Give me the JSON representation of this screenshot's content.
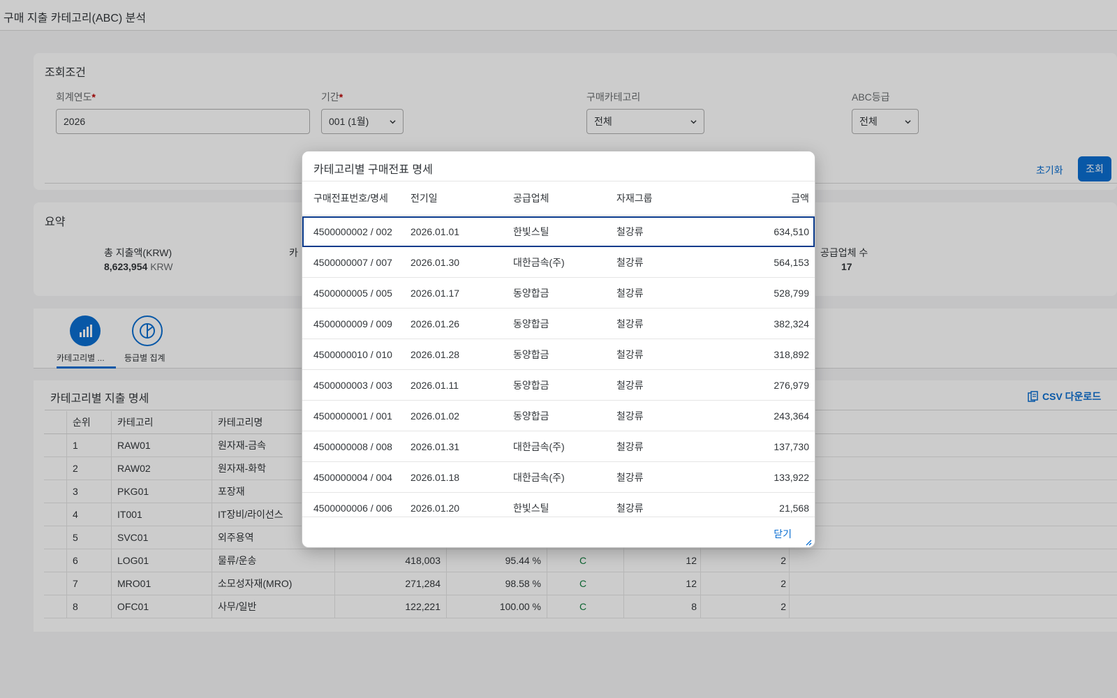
{
  "app": {
    "title": "구매 지출 카테고리(ABC) 분석"
  },
  "filter": {
    "title": "조회조건",
    "fiscal_year_label": "회계연도",
    "fiscal_year_value": "2026",
    "period_label": "기간",
    "period_value": "001 (1월)",
    "category_label": "구매카테고리",
    "category_value": "전체",
    "abc_label": "ABC등급",
    "abc_value": "전체",
    "required_mark": "*",
    "reset_label": "초기화",
    "search_label": "조회"
  },
  "summary": {
    "title": "요약",
    "total_label": "총 지출액(KRW)",
    "total_value": "8,623,954",
    "total_unit": "KRW",
    "partial_label": "카",
    "vendor_label": "공급업체 수",
    "vendor_value": "17"
  },
  "tabs": [
    {
      "label": "카테고리별 ...",
      "icon": "bar-chart-icon"
    },
    {
      "label": "등급별 집계",
      "icon": "pie-chart-icon"
    }
  ],
  "table": {
    "title": "카테고리별 지출 명세",
    "csv_label": "CSV 다운로드",
    "columns": [
      "순위",
      "카테고리",
      "카테고리명"
    ],
    "rows": [
      {
        "rank": "1",
        "code": "RAW01",
        "name": "원자재-금속",
        "amount": "",
        "cum": "",
        "grade": "",
        "docs": "",
        "vendors": ""
      },
      {
        "rank": "2",
        "code": "RAW02",
        "name": "원자재-화학",
        "amount": "",
        "cum": "",
        "grade": "",
        "docs": "",
        "vendors": ""
      },
      {
        "rank": "3",
        "code": "PKG01",
        "name": "포장재",
        "amount": "",
        "cum": "",
        "grade": "",
        "docs": "",
        "vendors": ""
      },
      {
        "rank": "4",
        "code": "IT001",
        "name": "IT장비/라이선스",
        "amount": "",
        "cum": "",
        "grade": "",
        "docs": "",
        "vendors": ""
      },
      {
        "rank": "5",
        "code": "SVC01",
        "name": "외주용역",
        "amount": "",
        "cum": "",
        "grade": "",
        "docs": "",
        "vendors": ""
      },
      {
        "rank": "6",
        "code": "LOG01",
        "name": "물류/운송",
        "amount": "418,003",
        "cum": "95.44 %",
        "grade": "C",
        "docs": "12",
        "vendors": "2"
      },
      {
        "rank": "7",
        "code": "MRO01",
        "name": "소모성자재(MRO)",
        "amount": "271,284",
        "cum": "98.58 %",
        "grade": "C",
        "docs": "12",
        "vendors": "2"
      },
      {
        "rank": "8",
        "code": "OFC01",
        "name": "사무/일반",
        "amount": "122,221",
        "cum": "100.00 %",
        "grade": "C",
        "docs": "8",
        "vendors": "2"
      }
    ]
  },
  "dialog": {
    "title": "카테고리별 구매전표 명세",
    "columns": [
      "구매전표번호/명세",
      "전기일",
      "공급업체",
      "자재그룹",
      "금액"
    ],
    "rows": [
      {
        "doc": "4500000002 / 002",
        "date": "2026.01.01",
        "vendor": "한빛스틸",
        "group": "철강류",
        "amount": "634,510"
      },
      {
        "doc": "4500000007 / 007",
        "date": "2026.01.30",
        "vendor": "대한금속(주)",
        "group": "철강류",
        "amount": "564,153"
      },
      {
        "doc": "4500000005 / 005",
        "date": "2026.01.17",
        "vendor": "동양합금",
        "group": "철강류",
        "amount": "528,799"
      },
      {
        "doc": "4500000009 / 009",
        "date": "2026.01.26",
        "vendor": "동양합금",
        "group": "철강류",
        "amount": "382,324"
      },
      {
        "doc": "4500000010 / 010",
        "date": "2026.01.28",
        "vendor": "동양합금",
        "group": "철강류",
        "amount": "318,892"
      },
      {
        "doc": "4500000003 / 003",
        "date": "2026.01.11",
        "vendor": "동양합금",
        "group": "철강류",
        "amount": "276,979"
      },
      {
        "doc": "4500000001 / 001",
        "date": "2026.01.02",
        "vendor": "동양합금",
        "group": "철강류",
        "amount": "243,364"
      },
      {
        "doc": "4500000008 / 008",
        "date": "2026.01.31",
        "vendor": "대한금속(주)",
        "group": "철강류",
        "amount": "137,730"
      },
      {
        "doc": "4500000004 / 004",
        "date": "2026.01.18",
        "vendor": "대한금속(주)",
        "group": "철강류",
        "amount": "133,922"
      },
      {
        "doc": "4500000006 / 006",
        "date": "2026.01.20",
        "vendor": "한빛스틸",
        "group": "철강류",
        "amount": "21,568"
      }
    ],
    "close_label": "닫기"
  },
  "colors": {
    "accent": "#0a6ed1",
    "grade_c": "#107e3e",
    "selected_border": "#0a3a8c"
  }
}
